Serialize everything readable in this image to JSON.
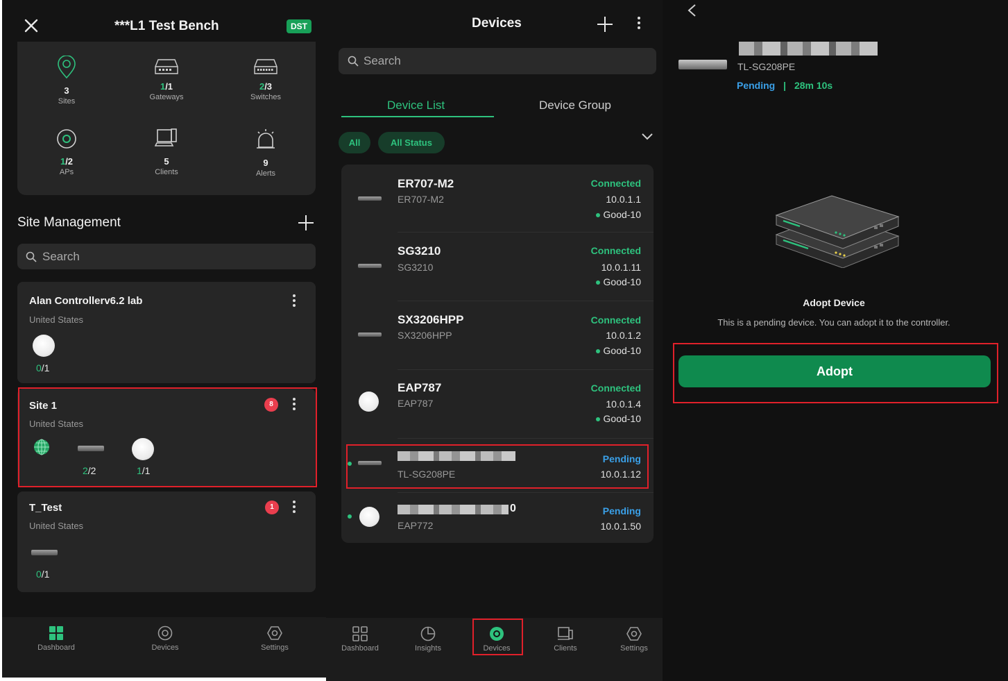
{
  "dashboard": {
    "title": "***L1 Test Bench",
    "dst_badge": "DST",
    "stats": [
      {
        "icon": "site-pin-icon",
        "value": "3",
        "value_accent": "",
        "value_rest": "3",
        "label": "Sites"
      },
      {
        "icon": "gateway-icon",
        "value": "1/1",
        "value_accent": "1",
        "value_rest": "/1",
        "label": "Gateways"
      },
      {
        "icon": "switch-icon",
        "value": "2/3",
        "value_accent": "2",
        "value_rest": "/3",
        "label": "Switches"
      },
      {
        "icon": "ap-icon",
        "value": "1/2",
        "value_accent": "1",
        "value_rest": "/2",
        "label": "APs"
      },
      {
        "icon": "client-icon",
        "value": "5",
        "value_accent": "",
        "value_rest": "5",
        "label": "Clients"
      },
      {
        "icon": "alarm-icon",
        "value": "9",
        "value_accent": "",
        "value_rest": "9",
        "label": "Alerts"
      }
    ],
    "site_management": {
      "title": "Site Management",
      "search_placeholder": "Search",
      "sites": [
        {
          "name": "Alan Controllerv6.2 lab",
          "country": "United States",
          "badge": "",
          "ratios": [
            {
              "accent": "0",
              "rest": "/1"
            }
          ]
        },
        {
          "name": "Site 1",
          "country": "United States",
          "badge": "8",
          "ratios": [
            {
              "accent": "2",
              "rest": "/2"
            },
            {
              "accent": "1",
              "rest": "/1"
            }
          ]
        },
        {
          "name": "T_Test",
          "country": "United States",
          "badge": "1",
          "ratios": [
            {
              "accent": "0",
              "rest": "/1"
            }
          ]
        }
      ]
    },
    "tabbar": [
      {
        "label": "Dashboard",
        "active": true
      },
      {
        "label": "Devices",
        "active": false
      },
      {
        "label": "Settings",
        "active": false
      }
    ]
  },
  "devices": {
    "title": "Devices",
    "search_placeholder": "Search",
    "tabs": [
      {
        "label": "Device List",
        "active": true
      },
      {
        "label": "Device Group",
        "active": false
      }
    ],
    "filters": [
      "All",
      "All Status"
    ],
    "list": [
      {
        "name": "ER707-M2",
        "model": "ER707-M2",
        "status": "Connected",
        "ip": "10.0.1.1",
        "health": "Good-10",
        "type": "router"
      },
      {
        "name": "SG3210",
        "model": "SG3210",
        "status": "Connected",
        "ip": "10.0.1.11",
        "health": "Good-10",
        "type": "switch"
      },
      {
        "name": "SX3206HPP",
        "model": "SX3206HPP",
        "status": "Connected",
        "ip": "10.0.1.2",
        "health": "Good-10",
        "type": "switch"
      },
      {
        "name": "EAP787",
        "model": "EAP787",
        "status": "Connected",
        "ip": "10.0.1.4",
        "health": "Good-10",
        "type": "ap"
      },
      {
        "name": "",
        "model": "TL-SG208PE",
        "status": "Pending",
        "ip": "10.0.1.12",
        "health": "",
        "type": "switch"
      },
      {
        "name": "0",
        "model": "EAP772",
        "status": "Pending",
        "ip": "10.0.1.50",
        "health": "",
        "type": "ap"
      }
    ],
    "tabbar": [
      {
        "label": "Dashboard",
        "active": false
      },
      {
        "label": "Insights",
        "active": false
      },
      {
        "label": "Devices",
        "active": true
      },
      {
        "label": "Clients",
        "active": false
      },
      {
        "label": "Settings",
        "active": false
      }
    ]
  },
  "adopt": {
    "model": "TL-SG208PE",
    "status": "Pending",
    "separator": "|",
    "uptime": "28m 10s",
    "heading": "Adopt Device",
    "description": "This is a pending device. You can adopt it to the controller.",
    "button": "Adopt"
  },
  "colors": {
    "accent": "#2ec27e",
    "pending": "#3aa0e8",
    "highlight": "#e0202a",
    "button": "#0f8a4e"
  }
}
